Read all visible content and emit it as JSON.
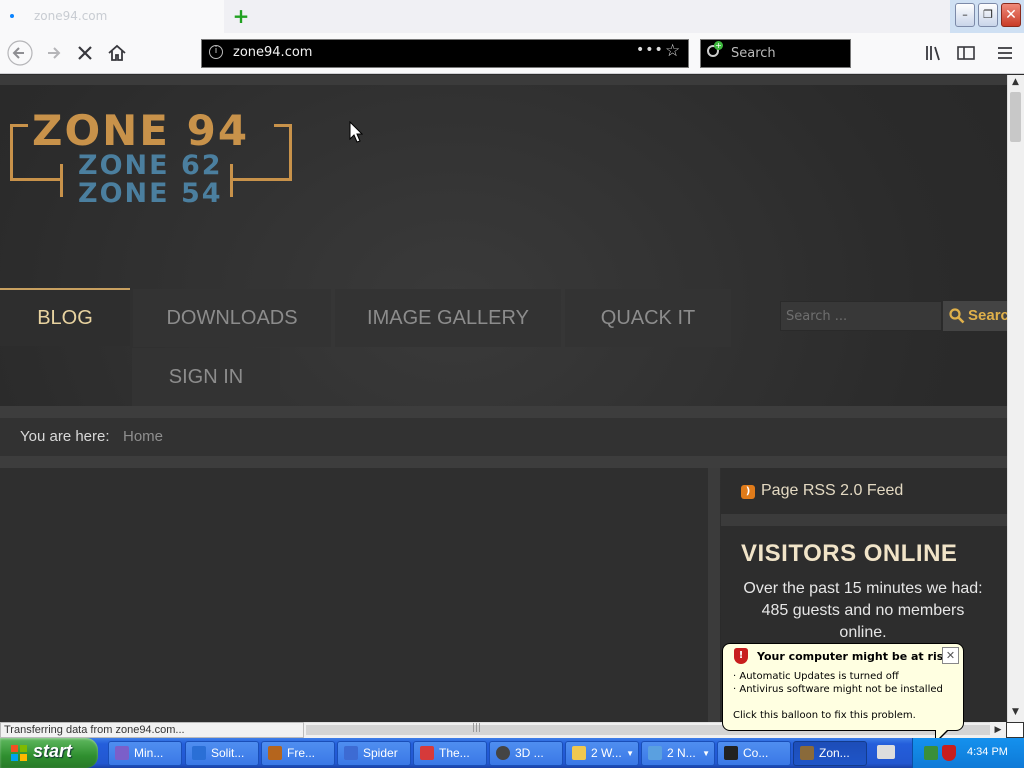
{
  "browser": {
    "tab_title": "zone94.com",
    "new_tab_label": "+",
    "url": "zone94.com",
    "url_menu_dots": "•••",
    "search_placeholder": "Search",
    "window_buttons": {
      "minimize": "–",
      "restore": "❐",
      "close": "✕"
    }
  },
  "site": {
    "logo": {
      "main": "ZONE 94",
      "sub1": "ZONE 62",
      "sub2": "ZONE 54"
    },
    "menu": [
      {
        "label": "BLOG",
        "active": true
      },
      {
        "label": "DOWNLOADS"
      },
      {
        "label": "IMAGE GALLERY"
      },
      {
        "label": "QUACK IT"
      },
      {
        "label": "SIGN IN"
      }
    ],
    "search": {
      "placeholder": "Search ...",
      "button": "Search"
    },
    "breadcrumb": {
      "label": "You are here:",
      "home": "Home"
    },
    "rss": {
      "label": "Page RSS 2.0 Feed"
    },
    "visitors": {
      "title": "VISITORS ONLINE",
      "body": "Over the past 15 minutes we had: 485 guests and no members online."
    }
  },
  "status_bar": {
    "text": "Transferring data from zone94.com..."
  },
  "balloon": {
    "title": "Your computer might be at risk",
    "line1": "· Automatic Updates is turned off",
    "line2": "· Antivirus software might not be installed",
    "line3": "Click this balloon to fix this problem."
  },
  "taskbar": {
    "start_label": "start",
    "tasks": [
      {
        "label": "Min...",
        "icon_color": "#7b5fc9"
      },
      {
        "label": "Solit...",
        "icon_color": "#2a6fd6"
      },
      {
        "label": "Fre...",
        "icon_color": "#b5651d"
      },
      {
        "label": "Spider",
        "icon_color": "#3d6bd3"
      },
      {
        "label": "The...",
        "icon_color": "#d63a3a"
      },
      {
        "label": "3D ...",
        "icon_color": "#444444"
      },
      {
        "label": "2 W...",
        "icon_color": "#f0c850"
      },
      {
        "label": "2 N...",
        "icon_color": "#5aa0e0"
      },
      {
        "label": "Co...",
        "icon_color": "#222222"
      },
      {
        "label": "Zon...",
        "icon_color": "#8a6a3a",
        "active": true
      }
    ],
    "clock": "4:34 PM"
  }
}
